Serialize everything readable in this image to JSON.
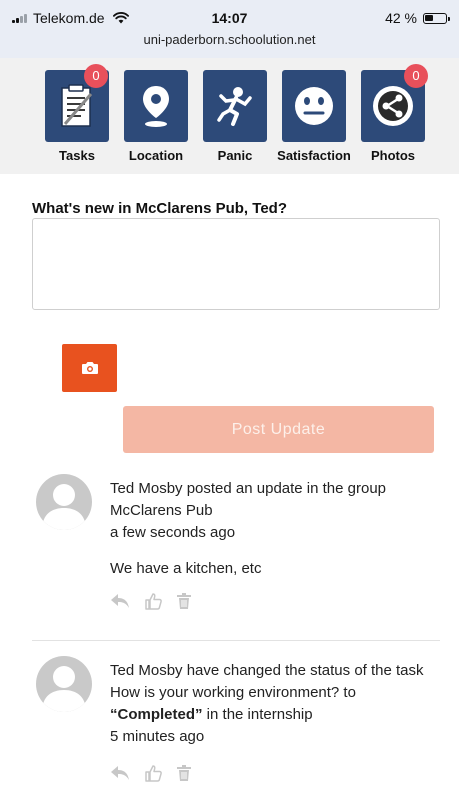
{
  "status_bar": {
    "carrier": "Telekom.de",
    "time": "14:07",
    "battery": "42 %",
    "battery_level": 0.42,
    "url": "uni-paderborn.schoolution.net"
  },
  "nav": {
    "items": [
      {
        "label": "Tasks",
        "icon": "task-list-icon",
        "badge": "0"
      },
      {
        "label": "Location",
        "icon": "location-pin-icon"
      },
      {
        "label": "Panic",
        "icon": "running-figure-icon"
      },
      {
        "label": "Satisfaction",
        "icon": "smiley-face-icon"
      },
      {
        "label": "Photos",
        "icon": "share-icon",
        "badge": "0"
      }
    ]
  },
  "composer": {
    "prompt": "What's new in McClarens Pub, Ted?",
    "value": "",
    "camera_icon": "camera-icon",
    "post_label": "Post Update"
  },
  "activities": [
    {
      "text": "Ted Mosby posted an update in the group McClarens Pub",
      "time": "a few seconds ago",
      "content": "We have a kitchen, etc"
    },
    {
      "text_before": "Ted Mosby have changed the status of the task How is your working environment? to ",
      "status": "“Completed”",
      "text_after": " in the internship",
      "time": "5 minutes ago"
    }
  ],
  "colors": {
    "nav_tile": "#2d4a79",
    "badge": "#e8505b",
    "camera_button": "#e8521f",
    "post_button": "#f4b7a4"
  }
}
